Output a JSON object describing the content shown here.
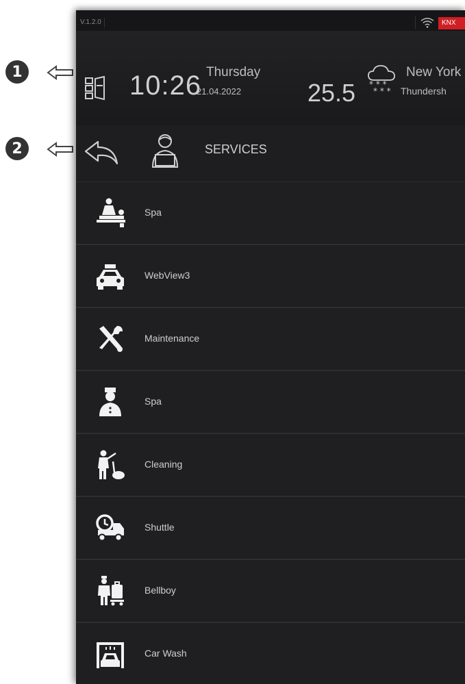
{
  "annotations": {
    "marker_1": "1",
    "marker_2": "2"
  },
  "statusbar": {
    "version": "V.1.2.0",
    "badge": "KNX",
    "badge_color": "#d01e24"
  },
  "header": {
    "time": "10:26",
    "day": "Thursday",
    "date": "21.04.2022",
    "temperature": "25.5",
    "city": "New York",
    "condition": "Thundersh",
    "weather_icon": "cloud-snow-icon"
  },
  "navbar": {
    "title": "SERVICES",
    "back_icon": "back-arrow-icon",
    "title_icon": "concierge-laptop-icon"
  },
  "services": [
    {
      "label": "Spa",
      "icon": "massage-icon"
    },
    {
      "label": "WebView3",
      "icon": "taxi-icon"
    },
    {
      "label": "Maintenance",
      "icon": "tools-icon"
    },
    {
      "label": "Spa",
      "icon": "doorman-icon"
    },
    {
      "label": "Cleaning",
      "icon": "cleaning-icon"
    },
    {
      "label": "Shuttle",
      "icon": "shuttle-icon"
    },
    {
      "label": "Bellboy",
      "icon": "bellboy-icon"
    },
    {
      "label": "Car Wash",
      "icon": "car-wash-icon"
    }
  ]
}
